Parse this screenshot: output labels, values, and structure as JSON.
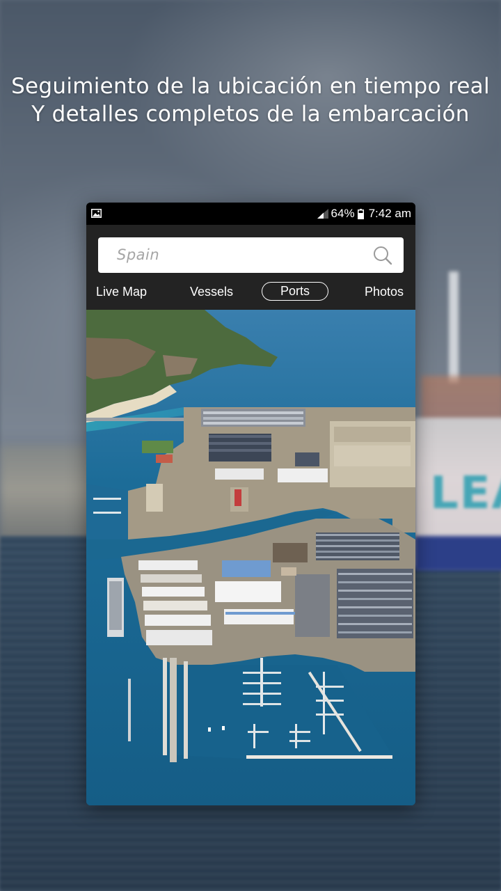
{
  "promo": {
    "headline_line1": "Seguimiento de la ubicación en tiempo real",
    "headline_line2": "Y detalles completos de la embarcación"
  },
  "background": {
    "ship_text": "LEAR"
  },
  "status_bar": {
    "battery": "64%",
    "time": "7:42 am",
    "left_icon": "image-icon",
    "signal_icon": "signal-icon",
    "battery_icon": "battery-icon"
  },
  "search": {
    "value": "Spain",
    "icon": "search-icon"
  },
  "tabs": [
    {
      "label": "Live Map",
      "selected": false
    },
    {
      "label": "Vessels",
      "selected": false
    },
    {
      "label": "Ports",
      "selected": true
    },
    {
      "label": "Photos",
      "selected": false
    }
  ],
  "colors": {
    "app_bar": "#232323",
    "status_bar": "#000000",
    "water": "#1f6d97",
    "text_light": "#ffffff"
  }
}
